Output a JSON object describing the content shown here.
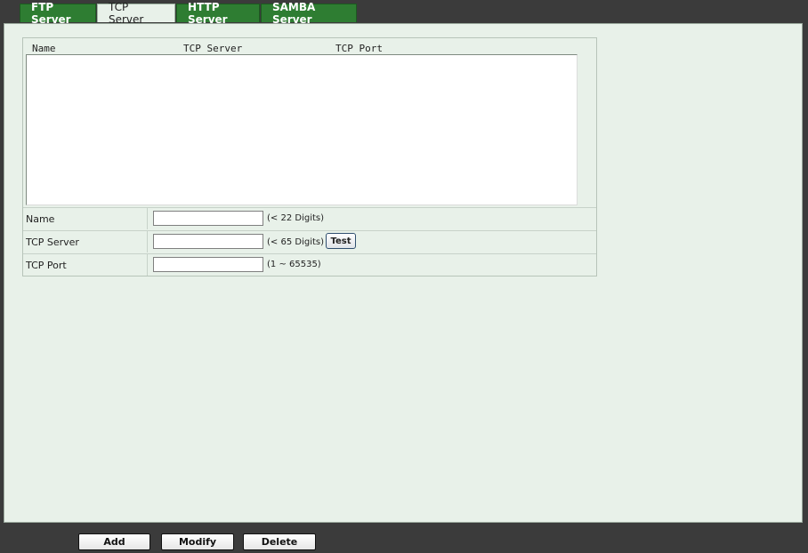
{
  "tabs": {
    "ftp": "FTP Server",
    "tcp": "TCP Server",
    "http": "HTTP Server",
    "samba": "SAMBA Server",
    "active": "TCP Server"
  },
  "list": {
    "columns": [
      "Name",
      "TCP Server",
      "TCP Port"
    ],
    "rows": []
  },
  "form": {
    "name": {
      "label": "Name",
      "value": "",
      "hint": "(< 22 Digits)"
    },
    "server": {
      "label": "TCP Server",
      "value": "",
      "hint": "(< 65 Digits)",
      "test_label": "Test"
    },
    "port": {
      "label": "TCP Port",
      "value": "",
      "hint": "(1 ~ 65535)"
    }
  },
  "buttons": {
    "add": "Add",
    "modify": "Modify",
    "delete": "Delete"
  },
  "colors": {
    "tab_green": "#2e7d32",
    "panel_bg": "#e8f1e9",
    "frame_bg": "#3b3b3b"
  }
}
